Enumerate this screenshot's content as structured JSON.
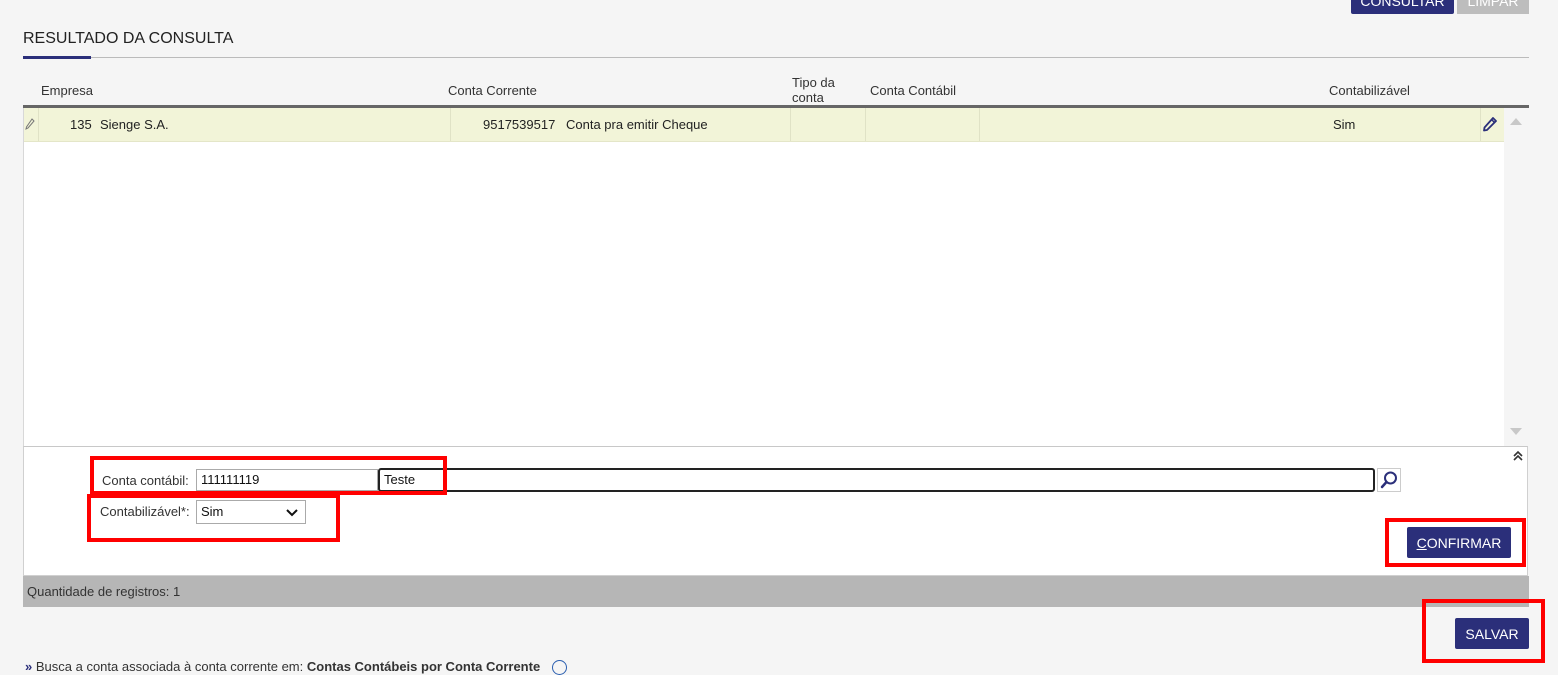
{
  "top_buttons": {
    "consultar": "CONSULTAR",
    "limpar": "LIMPAR"
  },
  "section": {
    "title": "RESULTADO DA CONSULTA"
  },
  "grid": {
    "columns": {
      "empresa": "Empresa",
      "conta_corrente": "Conta Corrente",
      "tipo_conta_line1": "Tipo da",
      "tipo_conta_line2": "conta",
      "conta_contabil": "Conta Contábil",
      "contabilizavel": "Contabilizável"
    },
    "rows": [
      {
        "empresa_code": "135",
        "empresa_name": "Sienge S.A.",
        "conta_corrente_num": "9517539517",
        "conta_corrente_desc": "Conta pra emitir Cheque",
        "tipo_conta": "",
        "conta_contabil": "",
        "contabilizavel": "Sim"
      }
    ]
  },
  "edit_form": {
    "conta_contabil_label": "Conta contábil:",
    "conta_contabil_code": "111111119",
    "conta_contabil_desc": "Teste",
    "contabilizavel_label": "Contabilizável*:",
    "contabilizavel_value": "Sim",
    "confirmar_label": "CONFIRMAR"
  },
  "footer": {
    "quantidade_registros": "Quantidade de registros: 1"
  },
  "salvar_label": "SALVAR",
  "bottom_note": {
    "prefix": "Busca a conta associada à conta corrente em:",
    "link": "Contas Contábeis por Conta Corrente"
  },
  "colors": {
    "accent": "#2b2f7a",
    "highlight_row": "#f2f4d8",
    "annotation_red": "#ff0000"
  }
}
